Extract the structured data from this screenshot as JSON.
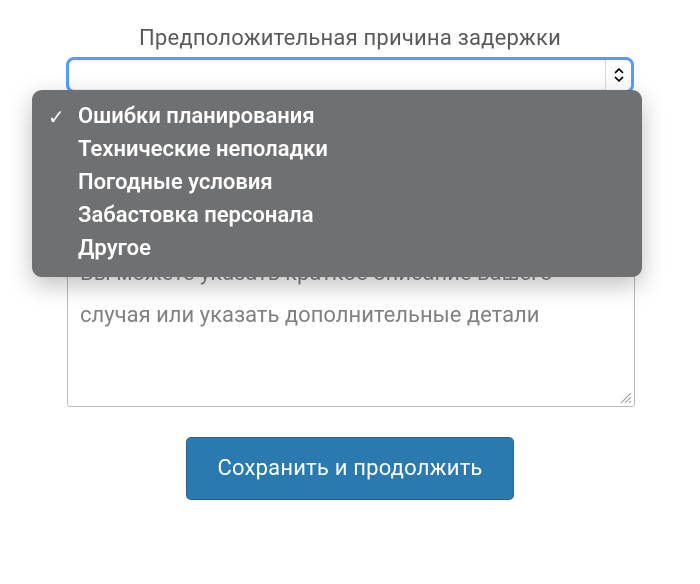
{
  "form": {
    "reason_label": "Предположительная причина задержки",
    "reason_select": {
      "selected_index": 0,
      "options": [
        "Ошибки планирования",
        "Технические неполадки",
        "Погодные условия",
        "Забастовка персонала",
        "Другое"
      ],
      "value": ""
    },
    "notes": {
      "placeholder": "Вы можете указать краткое описание вашего случая или указать дополнительные детали",
      "value": ""
    },
    "submit_label": "Сохранить и продолжить"
  },
  "colors": {
    "focus_ring": "#549cff",
    "dropdown_bg": "#6e7072",
    "primary": "#2a7aaf",
    "text_muted": "#595a5c",
    "placeholder": "#808083"
  }
}
